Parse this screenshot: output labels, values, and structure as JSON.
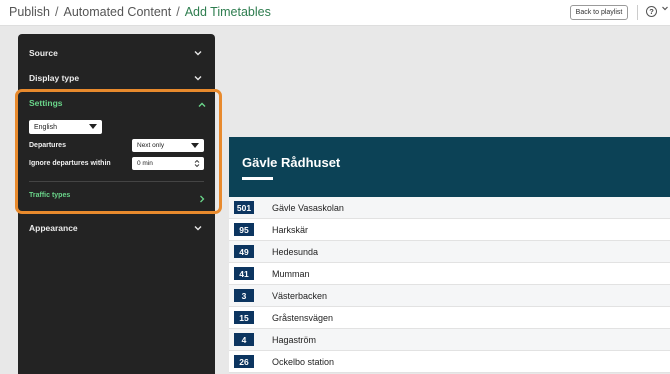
{
  "breadcrumb": {
    "items": [
      "Publish",
      "Automated Content",
      "Add Timetables"
    ],
    "separator": "/"
  },
  "topbar": {
    "back_button": "Back to playlist",
    "help_icon": "question-circle-icon",
    "help_label": "?"
  },
  "panel": {
    "sections": {
      "source": "Source",
      "display_type": "Display type",
      "settings": "Settings",
      "appearance": "Appearance"
    },
    "settings": {
      "language": "English",
      "departures_label": "Departures",
      "departures_value": "Next only",
      "ignore_label": "Ignore departures within",
      "ignore_value": "0 min",
      "traffic_types": "Traffic types"
    }
  },
  "colors": {
    "accent_green": "#6ad58a",
    "highlight_orange": "#e88a2d",
    "header_teal": "#0c4256",
    "badge_navy": "#0c3560"
  },
  "timetable": {
    "stop_name": "Gävle Rådhuset",
    "rows": [
      {
        "line": "501",
        "destination": "Gävle Vasaskolan"
      },
      {
        "line": "95",
        "destination": "Harkskär"
      },
      {
        "line": "49",
        "destination": "Hedesunda"
      },
      {
        "line": "41",
        "destination": "Mumman"
      },
      {
        "line": "3",
        "destination": "Västerbacken"
      },
      {
        "line": "15",
        "destination": "Gråstensvägen"
      },
      {
        "line": "4",
        "destination": "Hagaström"
      },
      {
        "line": "26",
        "destination": "Ockelbo station"
      }
    ]
  }
}
